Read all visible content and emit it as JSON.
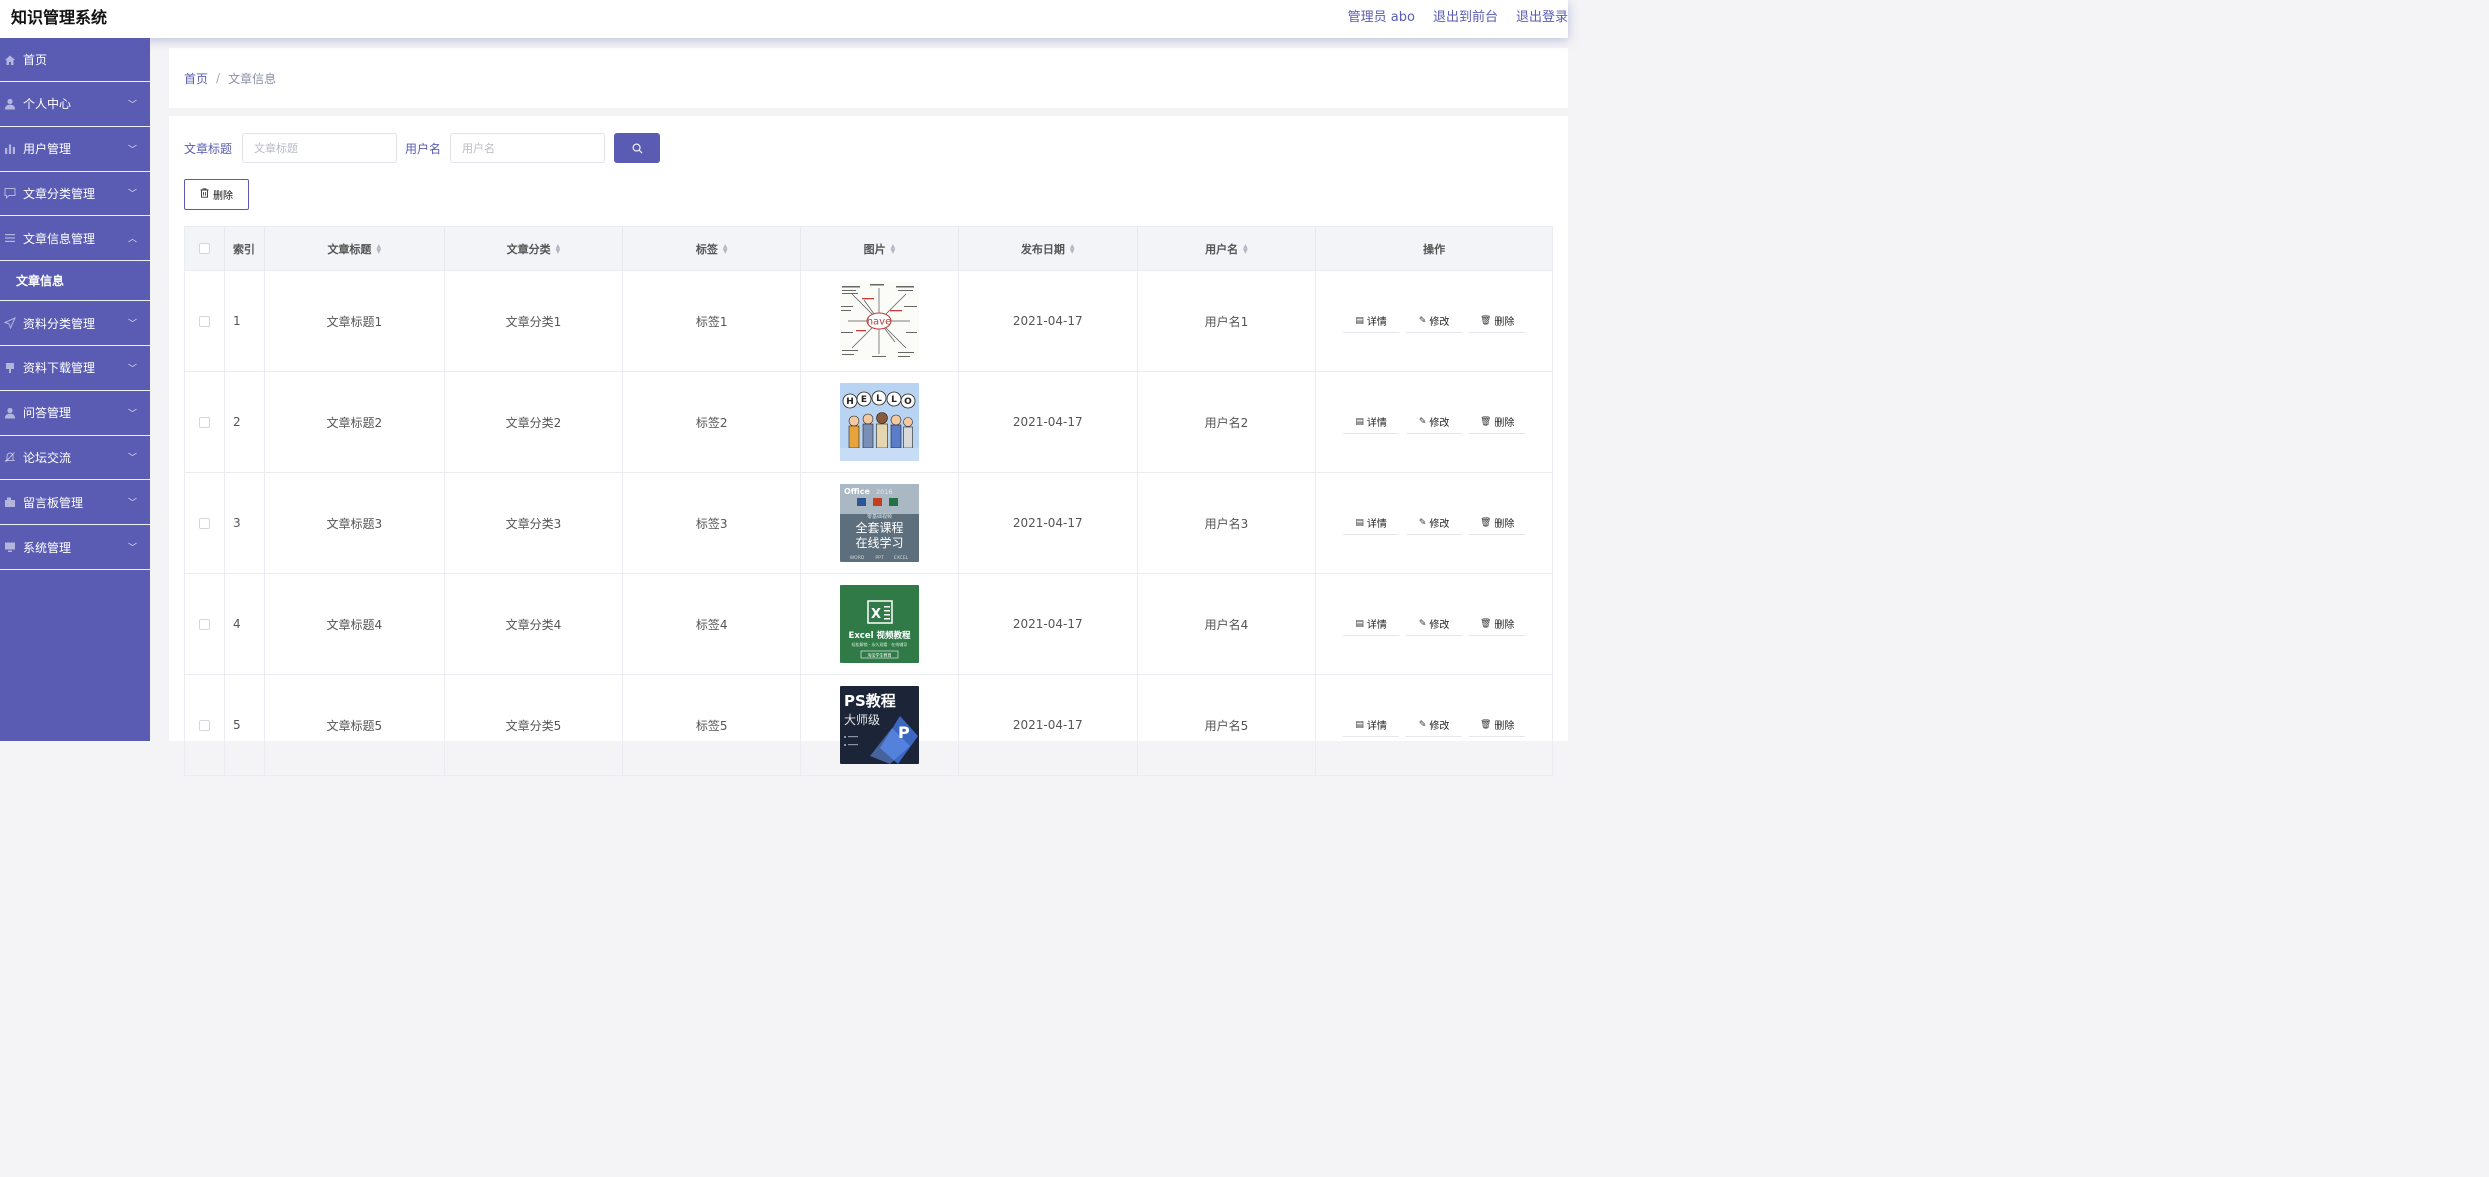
{
  "header": {
    "app_title": "知识管理系统",
    "admin_label": "管理员 abo",
    "to_front_label": "退出到前台",
    "logout_label": "退出登录"
  },
  "sidebar": {
    "items": [
      {
        "label": "首页",
        "icon": "home-icon"
      },
      {
        "label": "个人中心",
        "icon": "user-icon"
      },
      {
        "label": "用户管理",
        "icon": "bar-chart-icon"
      },
      {
        "label": "文章分类管理",
        "icon": "chat-icon"
      },
      {
        "label": "文章信息管理",
        "icon": "list-icon",
        "expanded": true
      },
      {
        "label": "资料分类管理",
        "icon": "send-icon"
      },
      {
        "label": "资料下载管理",
        "icon": "download-icon"
      },
      {
        "label": "问答管理",
        "icon": "user-icon"
      },
      {
        "label": "论坛交流",
        "icon": "bell-icon"
      },
      {
        "label": "留言板管理",
        "icon": "message-icon"
      },
      {
        "label": "系统管理",
        "icon": "monitor-icon"
      }
    ],
    "submenu_active": "文章信息"
  },
  "breadcrumb": {
    "home": "首页",
    "separator": "/",
    "current": "文章信息"
  },
  "filters": {
    "title_label": "文章标题",
    "title_placeholder": "文章标题",
    "username_label": "用户名",
    "username_placeholder": "用户名"
  },
  "toolbar": {
    "delete_label": "删除"
  },
  "table": {
    "columns": [
      "索引",
      "文章标题",
      "文章分类",
      "标签",
      "图片",
      "发布日期",
      "用户名",
      "操作"
    ],
    "action_labels": {
      "detail": "详情",
      "edit": "修改",
      "delete": "删除"
    },
    "rows": [
      {
        "index": "1",
        "title": "文章标题1",
        "category": "文章分类1",
        "tag": "标签1",
        "image": "have-word-map",
        "date": "2021-04-17",
        "username": "用户名1"
      },
      {
        "index": "2",
        "title": "文章标题2",
        "category": "文章分类2",
        "tag": "标签2",
        "image": "hello-cartoon",
        "date": "2021-04-17",
        "username": "用户名2"
      },
      {
        "index": "3",
        "title": "文章标题3",
        "category": "文章分类3",
        "tag": "标签3",
        "image": "office-course",
        "date": "2021-04-17",
        "username": "用户名3"
      },
      {
        "index": "4",
        "title": "文章标题4",
        "category": "文章分类4",
        "tag": "标签4",
        "image": "excel-course",
        "date": "2021-04-17",
        "username": "用户名4"
      },
      {
        "index": "5",
        "title": "文章标题5",
        "category": "文章分类5",
        "tag": "标签5",
        "image": "ps-course",
        "date": "2021-04-17",
        "username": "用户名5"
      }
    ]
  },
  "thumb_text": {
    "have": "have",
    "hello": [
      "H",
      "E",
      "L",
      "L",
      "O"
    ],
    "office_brand": "Office",
    "office_year": "2016",
    "office_sub": "零基础视频",
    "office_line1": "全套课程",
    "office_line2": "在线学习",
    "office_footer": [
      "WORD",
      "PPT",
      "EXCEL"
    ],
    "excel_mark": "X",
    "excel_title": "Excel 视频教程",
    "excel_sub": "轻松解锁 · 永久观看 · 在线辅导",
    "excel_btn": "淘宝学生教育",
    "ps_title": "PS教程",
    "ps_sub": "大师级",
    "ps_mark": "P"
  },
  "colors": {
    "primary": "#5a5cb4",
    "sidebar_bg": "#5a5cb4",
    "page_bg": "#f4f4f6"
  }
}
